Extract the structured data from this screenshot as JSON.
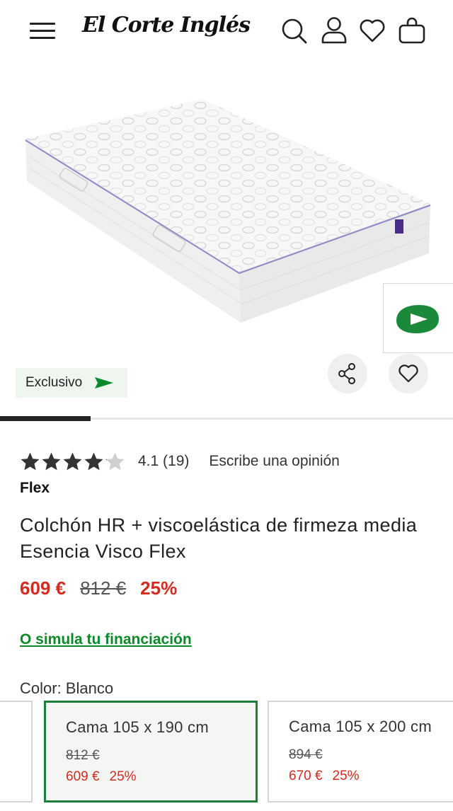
{
  "header": {
    "logo_text": "El Corte Inglés",
    "icons": [
      "menu-icon",
      "search-icon",
      "user-icon",
      "heart-icon",
      "bag-icon"
    ]
  },
  "hero": {
    "badge_label": "Exclusivo",
    "gallery_progress": 0.2,
    "icons": [
      "video-play-icon",
      "share-icon",
      "heart-icon"
    ]
  },
  "product": {
    "rating_value": "4.1",
    "rating_count": "(19)",
    "rating_stars": 4.1,
    "write_review": "Escribe una opinión",
    "brand": "Flex",
    "title": "Colchón HR + viscoelástica de firmeza media Esencia Visco Flex",
    "price_now": "609 €",
    "price_old": "812 €",
    "discount": "25%",
    "finance_link": "O simula tu financiación",
    "color_label": "Color: Blanco"
  },
  "size_options": [
    {
      "name": "Cama 105 x 190 cm",
      "old_price": "812 €",
      "price": "609 €",
      "discount": "25%",
      "selected": true
    },
    {
      "name": "Cama 105 x 200 cm",
      "old_price": "894 €",
      "price": "670 €",
      "discount": "25%",
      "selected": false
    }
  ],
  "colors": {
    "sale_red": "#d42b1e",
    "brand_green": "#0b8a2a",
    "selected_border": "#1b7f3a",
    "badge_bg": "#eef6ef"
  }
}
